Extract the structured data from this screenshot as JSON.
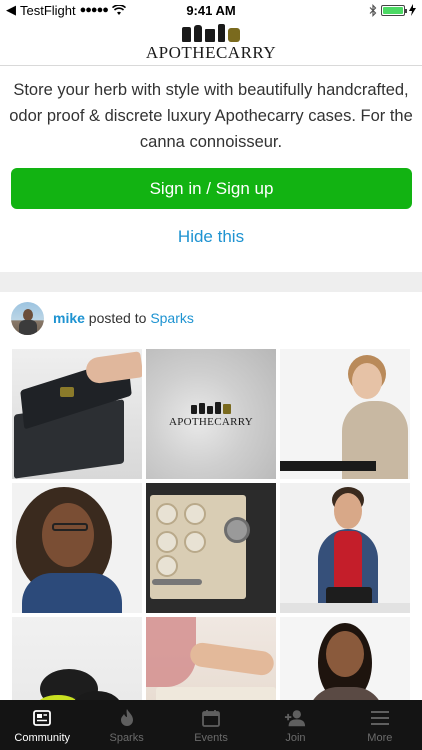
{
  "status_bar": {
    "carrier": "TestFlight",
    "signal": "●●●●●",
    "time": "9:41 AM"
  },
  "header": {
    "logo_text": "APOTHECARRY"
  },
  "intro": {
    "text": "Store your herb with style with beautifully handcrafted, odor proof & discrete luxury Apothecarry cases. For the canna connoisseur.",
    "signin_label": "Sign in / Sign up",
    "hide_label": "Hide this"
  },
  "post": {
    "author": "mike",
    "verb": " posted to ",
    "group": "Sparks",
    "images": [
      "black-case-image",
      "apothecarry-logo-image",
      "woman-presenting-image",
      "woman-portrait-image",
      "open-case-image",
      "man-presenting-image",
      "pads-image",
      "hand-case-image",
      "woman-smiling-image"
    ],
    "tile2_logo_text": "APOTHECARRY"
  },
  "tab_bar": {
    "tabs": [
      {
        "label": "Community",
        "icon": "community-icon",
        "active": true
      },
      {
        "label": "Sparks",
        "icon": "flame-icon",
        "active": false
      },
      {
        "label": "Events",
        "icon": "calendar-icon",
        "active": false
      },
      {
        "label": "Join",
        "icon": "add-user-icon",
        "active": false
      },
      {
        "label": "More",
        "icon": "menu-icon",
        "active": false
      }
    ]
  },
  "colors": {
    "brand_green": "#12b312",
    "link_blue": "#1e93d1",
    "tab_bar_bg": "#141414"
  }
}
